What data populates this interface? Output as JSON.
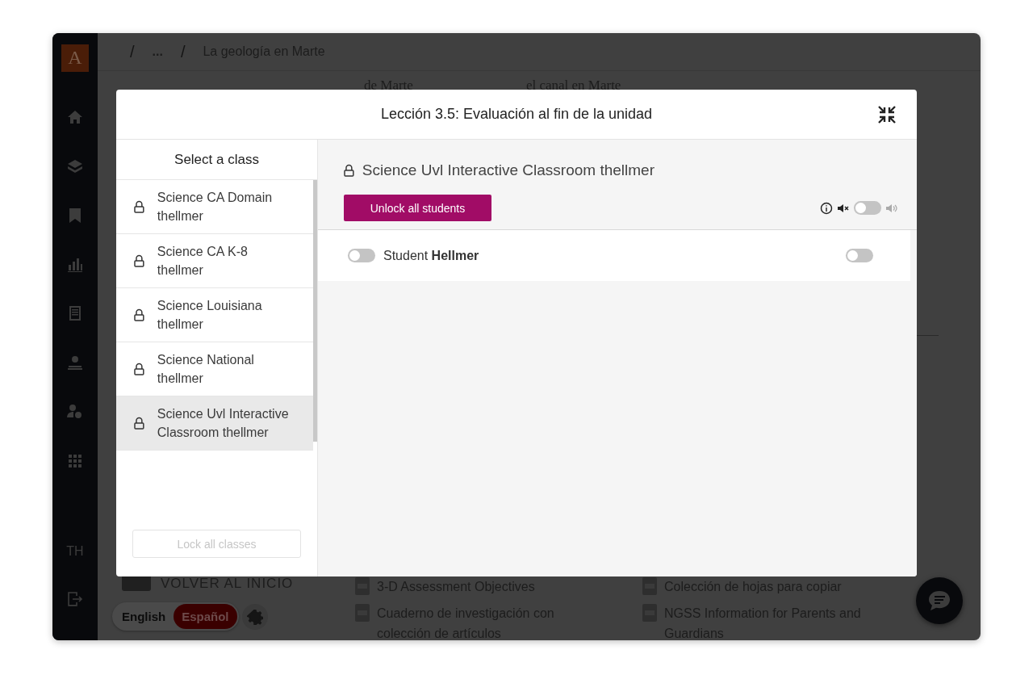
{
  "sidebar": {
    "logo": "A",
    "initials": "TH"
  },
  "breadcrumb": {
    "separators": [
      "/",
      "/"
    ],
    "ellipsis": "...",
    "current": "La geología en Marte"
  },
  "background": {
    "headings": [
      "de Marte",
      "el canal en Marte"
    ],
    "back_label": "VOLVER AL INICIO",
    "languages": [
      {
        "label": "English",
        "selected": false
      },
      {
        "label": "Español",
        "selected": true
      }
    ],
    "resources": [
      {
        "title": "3-D Assessment Objectives"
      },
      {
        "title": "Colección de hojas para copiar"
      },
      {
        "title": "Cuaderno de investigación con colección de artículos"
      },
      {
        "title": "NGSS Information for Parents and Guardians"
      }
    ]
  },
  "modal": {
    "title": "Lección 3.5: Evaluación al fin de la unidad",
    "class_list": {
      "heading": "Select a class",
      "items": [
        {
          "lines": [
            "Science CA Domain",
            "thellmer"
          ],
          "selected": false
        },
        {
          "lines": [
            "Science CA K-8",
            "thellmer"
          ],
          "selected": false
        },
        {
          "lines": [
            "Science Louisiana",
            "thellmer"
          ],
          "selected": false
        },
        {
          "lines": [
            "Science National",
            "thellmer"
          ],
          "selected": false
        },
        {
          "lines": [
            "Science Uvl Interactive",
            "Classroom thellmer"
          ],
          "selected": true
        }
      ],
      "lock_all": {
        "label": "Lock all classes",
        "disabled": true
      }
    },
    "class_panel": {
      "name": "Science Uvl Interactive Classroom thellmer",
      "unlock_all": "Unlock all students",
      "sound": {
        "on": false
      },
      "students": [
        {
          "name": "Student **Hellmer**",
          "unlocked": false,
          "sound_on": false
        }
      ]
    }
  }
}
